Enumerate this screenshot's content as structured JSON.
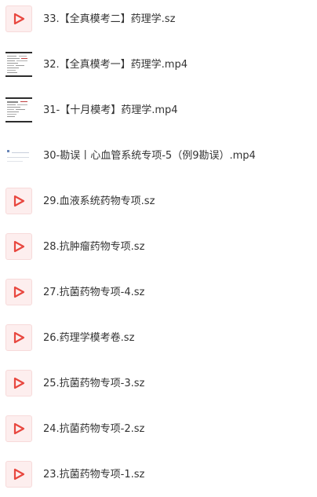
{
  "files": [
    {
      "name": "33.【全真模考二】药理学.sz",
      "icon": "play-file-icon"
    },
    {
      "name": "32.【全真模考一】药理学.mp4",
      "icon": "video-thumbnail-icon"
    },
    {
      "name": "31-【十月模考】药理学.mp4",
      "icon": "video-thumbnail-icon"
    },
    {
      "name": "30-勘误丨心血管系统专项-5（例9勘误）.mp4",
      "icon": "video-thumbnail-icon"
    },
    {
      "name": "29.血液系统药物专项.sz",
      "icon": "play-file-icon"
    },
    {
      "name": "28.抗肿瘤药物专项.sz",
      "icon": "play-file-icon"
    },
    {
      "name": "27.抗菌药物专项-4.sz",
      "icon": "play-file-icon"
    },
    {
      "name": "26.药理学模考卷.sz",
      "icon": "play-file-icon"
    },
    {
      "name": "25.抗菌药物专项-3.sz",
      "icon": "play-file-icon"
    },
    {
      "name": "24.抗菌药物专项-2.sz",
      "icon": "play-file-icon"
    },
    {
      "name": "23.抗菌药物专项-1.sz",
      "icon": "play-file-icon"
    }
  ],
  "colors": {
    "play_icon": "#e8473f",
    "icon_bg": "#fdeeee",
    "text": "#333333"
  }
}
